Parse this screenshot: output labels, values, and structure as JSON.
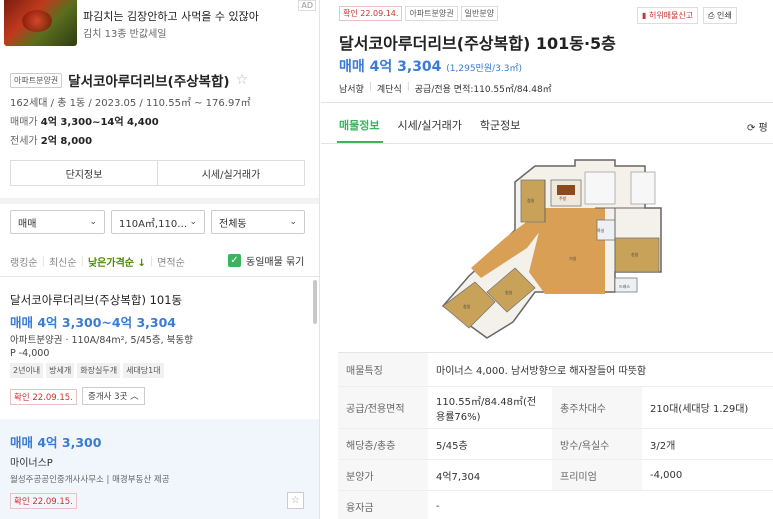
{
  "ad": {
    "title": "파김치는 김장안하고 사먹을 수 있잖아",
    "subtitle": "김치 13종 반값세일",
    "tag": "AD"
  },
  "complex": {
    "type_tag": "아파트분양권",
    "name": "달서코아루더리브(주상복합)",
    "info": "162세대 / 총 1동 / 2023.05 / 110.55㎡ ~ 176.97㎡",
    "sale_label": "매매가",
    "sale_value": "4억 3,300~14억 4,400",
    "rent_label": "전세가",
    "rent_value": "2억 8,000",
    "btn_info": "단지정보",
    "btn_price": "시세/실거래가"
  },
  "filters": {
    "trade": "매매",
    "area": "110A㎡,110…",
    "dong": "전체동"
  },
  "sort": {
    "items": [
      "랭킹순",
      "최신순",
      "낮은가격순 ↓",
      "면적순"
    ],
    "same_listing": "동일매물 묶기"
  },
  "listing1": {
    "title": "달서코아루더리브(주상복합) 101동",
    "price": "매매 4억 3,300~4억 3,304",
    "info": "아파트분양권 · 110A/84m², 5/45층, 북동향",
    "gap": "P -4,000",
    "tags": [
      "2년이내",
      "방세개",
      "화장실두개",
      "세대당1대"
    ],
    "confirm": "확인 22.09.15.",
    "agents": "중개사 3곳 ︿"
  },
  "listing2": {
    "price": "매매 4억 3,300",
    "gap": "마이너스P",
    "agent": "월성주공공인중개사사무소 | 매경부동산 제공",
    "confirm": "확인 22.09.15."
  },
  "detail": {
    "tags": [
      "확인 22.09.14.",
      "아파트분양권",
      "일반분양"
    ],
    "report": "허위매물신고",
    "print": "인쇄",
    "title": "달서코아루더리브(주상복합) 101동·5층",
    "price": "매매 4억 3,304",
    "price_per": "(1,295만원/3.3㎡)",
    "sub": [
      "남서향",
      "계단식",
      "공급/전용 면적:110.55㎡/84.48㎡"
    ],
    "tabs": [
      "매물정보",
      "시세/실거래가",
      "학군정보"
    ],
    "refresh": "⟳ 평",
    "rows": [
      {
        "k": "매물특징",
        "v": "마이너스 4,000. 남서방향으로 해자잘들어 따뜻함"
      },
      {
        "k": "공급/전용면적",
        "v": "110.55㎡/84.48㎡(전용률76%)",
        "k2": "총주차대수",
        "v2": "210대(세대당 1.29대)"
      },
      {
        "k": "해당층/총층",
        "v": "5/45층",
        "k2": "방수/욕실수",
        "v2": "3/2개"
      },
      {
        "k": "분양가",
        "v": "4억7,304",
        "k2": "프리미엄",
        "v2": "-4,000"
      },
      {
        "k": "융자금",
        "v": "-"
      }
    ]
  },
  "colors": {
    "accent_green": "#3ab55e",
    "price_blue": "#3a7bd5",
    "confirm_red": "#cc3333"
  }
}
